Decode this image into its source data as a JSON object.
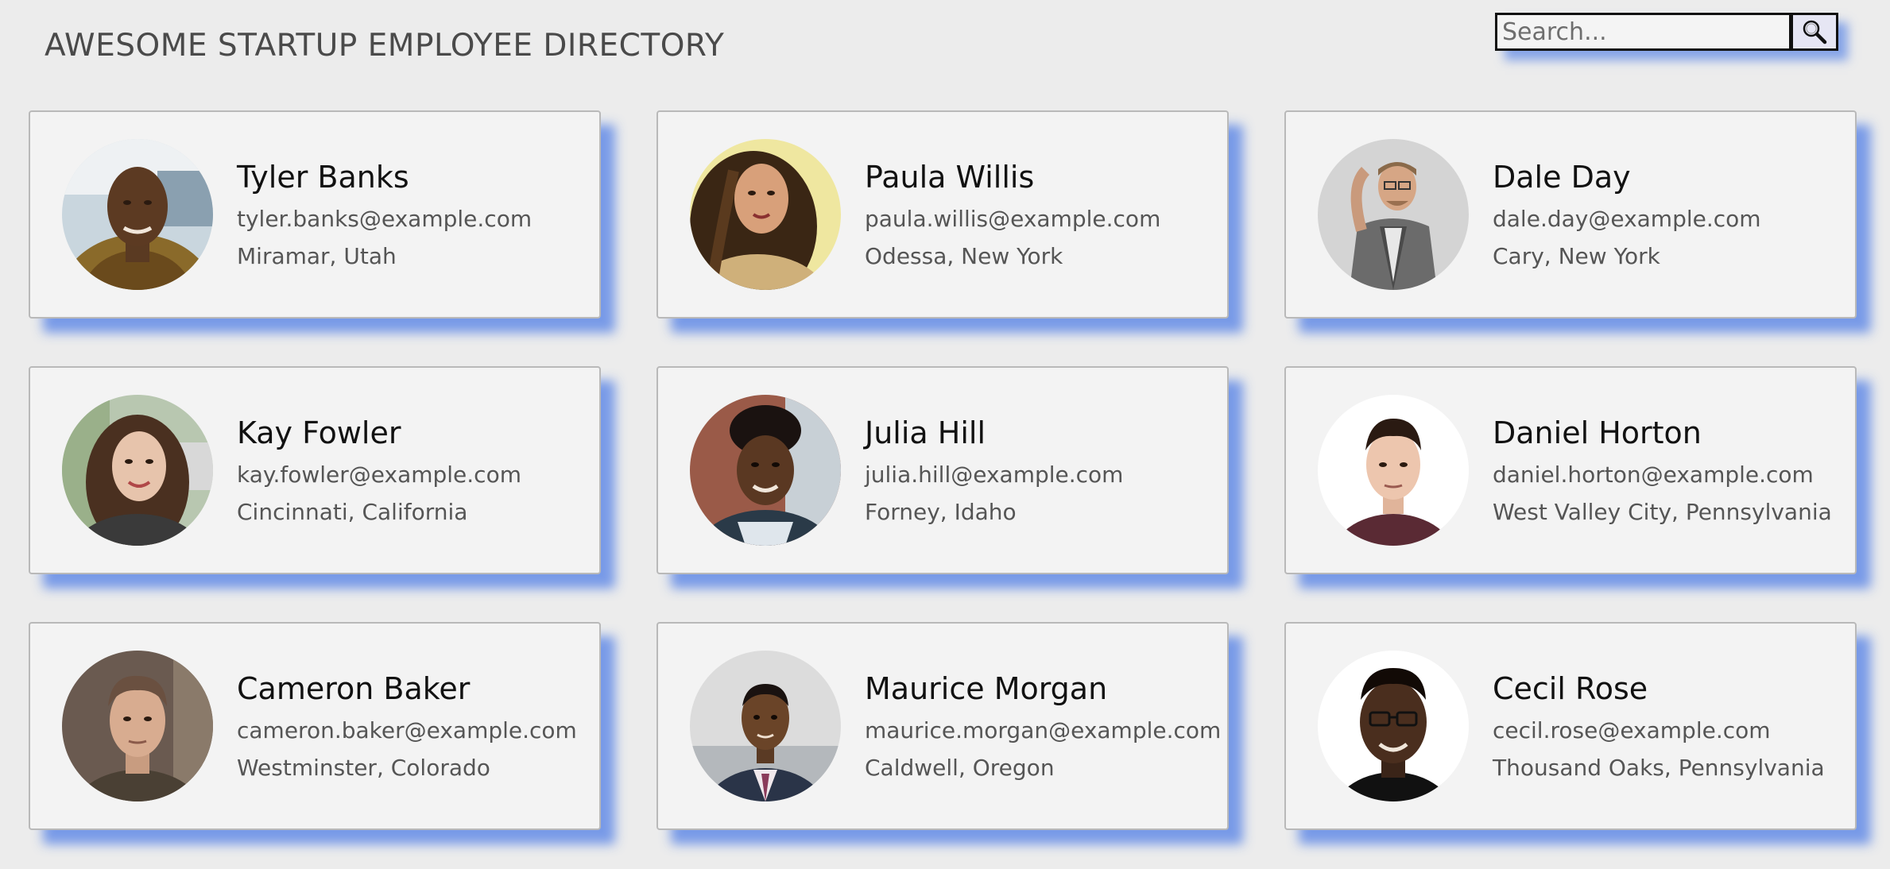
{
  "header": {
    "title": "AWESOME STARTUP EMPLOYEE DIRECTORY",
    "search": {
      "placeholder": "Search...",
      "value": "",
      "button_icon": "search-icon"
    }
  },
  "employees": [
    {
      "name": "Tyler Banks",
      "email": "tyler.banks@example.com",
      "location": "Miramar, Utah"
    },
    {
      "name": "Paula Willis",
      "email": "paula.willis@example.com",
      "location": "Odessa, New York"
    },
    {
      "name": "Dale Day",
      "email": "dale.day@example.com",
      "location": "Cary, New York"
    },
    {
      "name": "Kay Fowler",
      "email": "kay.fowler@example.com",
      "location": "Cincinnati, California"
    },
    {
      "name": "Julia Hill",
      "email": "julia.hill@example.com",
      "location": "Forney, Idaho"
    },
    {
      "name": "Daniel Horton",
      "email": "daniel.horton@example.com",
      "location": "West Valley City, Pennsylvania"
    },
    {
      "name": "Cameron Baker",
      "email": "cameron.baker@example.com",
      "location": "Westminster, Colorado"
    },
    {
      "name": "Maurice Morgan",
      "email": "maurice.morgan@example.com",
      "location": "Caldwell, Oregon"
    },
    {
      "name": "Cecil Rose",
      "email": "cecil.rose@example.com",
      "location": "Thousand Oaks, Pennsylvania"
    }
  ],
  "colors": {
    "page_background": "#ececec",
    "card_background": "#f3f3f3",
    "card_shadow": "#6f8ff0",
    "search_button_background": "#e6e6f4"
  }
}
